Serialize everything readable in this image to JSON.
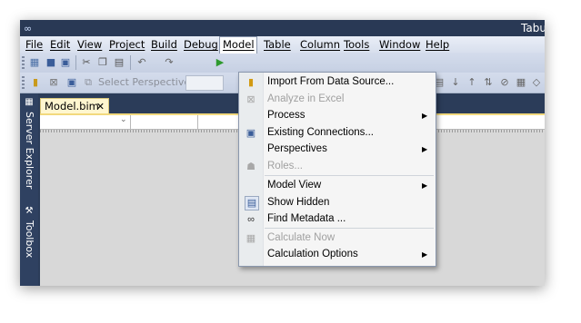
{
  "window": {
    "title": "Tabu",
    "icon": "infinity-logo-icon"
  },
  "menubar": {
    "items": [
      {
        "label": "File"
      },
      {
        "label": "Edit"
      },
      {
        "label": "View"
      },
      {
        "label": "Project"
      },
      {
        "label": "Build"
      },
      {
        "label": "Debug"
      },
      {
        "label": "Model"
      },
      {
        "label": "Table"
      },
      {
        "label": "Column"
      },
      {
        "label": "Tools"
      },
      {
        "label": "Window"
      },
      {
        "label": "Help"
      }
    ],
    "active": "Model"
  },
  "toolbar2": {
    "select_perspective": "Select Perspective"
  },
  "siderail": {
    "server_explorer": "Server Explorer",
    "toolbox": "Toolbox"
  },
  "document": {
    "tab_label": "Model.bim",
    "close": "✕",
    "dropdown": "⌄"
  },
  "model_menu": {
    "items": [
      {
        "label": "Import From Data Source...",
        "icon": "database-import-icon",
        "enabled": true
      },
      {
        "label": "Analyze in Excel",
        "icon": "excel-icon",
        "enabled": false
      },
      {
        "label": "Process",
        "icon": "",
        "enabled": true,
        "submenu": true
      },
      {
        "label": "Existing Connections...",
        "icon": "connection-icon",
        "enabled": true
      },
      {
        "label": "Perspectives",
        "icon": "",
        "enabled": true,
        "submenu": true
      },
      {
        "label": "Roles...",
        "icon": "roles-icon",
        "enabled": false
      },
      {
        "label": "Model View",
        "icon": "",
        "enabled": true,
        "submenu": true
      },
      {
        "label": "Show Hidden",
        "icon": "show-hidden-icon",
        "enabled": true,
        "checked": true
      },
      {
        "label": "Find Metadata ...",
        "icon": "binoculars-icon",
        "enabled": true
      },
      {
        "label": "Calculate Now",
        "icon": "calculator-icon",
        "enabled": false
      },
      {
        "label": "Calculation Options",
        "icon": "",
        "enabled": true,
        "submenu": true
      }
    ]
  },
  "colors": {
    "accent": "#293955",
    "menu_bg": "#f5f5f5",
    "tab": "#fff6cf"
  }
}
